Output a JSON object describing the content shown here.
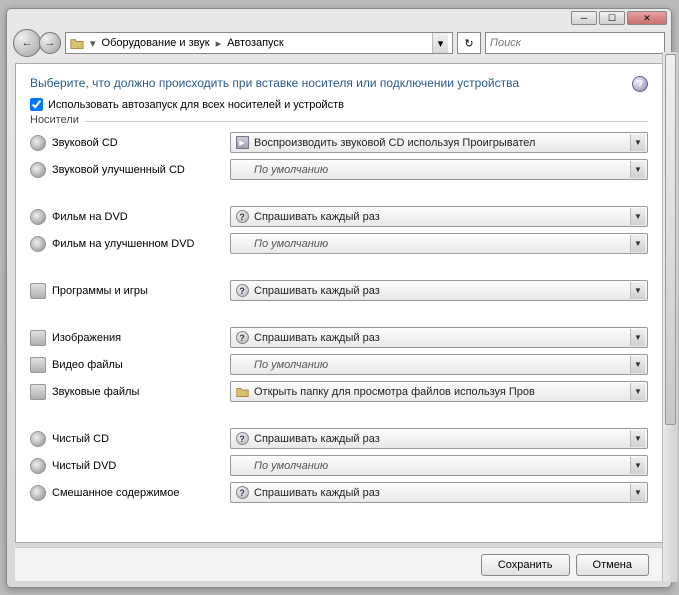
{
  "titlebar": {
    "min": "─",
    "max": "☐",
    "close": "✕"
  },
  "breadcrumb": {
    "segment1": "Оборудование и звук",
    "segment2": "Автозапуск"
  },
  "search": {
    "placeholder": "Поиск"
  },
  "heading": "Выберите, что должно происходить при вставке носителя или подключении устройства",
  "checkbox_label": "Использовать автозапуск для всех носителей и устройств",
  "section_label": "Носители",
  "rows": {
    "audio_cd": {
      "label": "Звуковой CD",
      "value": "Воспроизводить звуковой CD используя Проигрывател"
    },
    "enhanced_audio_cd": {
      "label": "Звуковой улучшенный CD",
      "value": "По умолчанию"
    },
    "dvd_movie": {
      "label": "Фильм на DVD",
      "value": "Спрашивать каждый раз"
    },
    "enhanced_dvd_movie": {
      "label": "Фильм на улучшенном DVD",
      "value": "По умолчанию"
    },
    "software": {
      "label": "Программы и игры",
      "value": "Спрашивать каждый раз"
    },
    "pictures": {
      "label": "Изображения",
      "value": "Спрашивать каждый раз"
    },
    "video_files": {
      "label": "Видео файлы",
      "value": "По умолчанию"
    },
    "audio_files": {
      "label": "Звуковые файлы",
      "value": "Открыть папку для просмотра файлов используя Пров"
    },
    "blank_cd": {
      "label": "Чистый CD",
      "value": "Спрашивать каждый раз"
    },
    "blank_dvd": {
      "label": "Чистый DVD",
      "value": "По умолчанию"
    },
    "mixed": {
      "label": "Смешанное содержимое",
      "value": "Спрашивать каждый раз"
    }
  },
  "buttons": {
    "save": "Сохранить",
    "cancel": "Отмена"
  }
}
